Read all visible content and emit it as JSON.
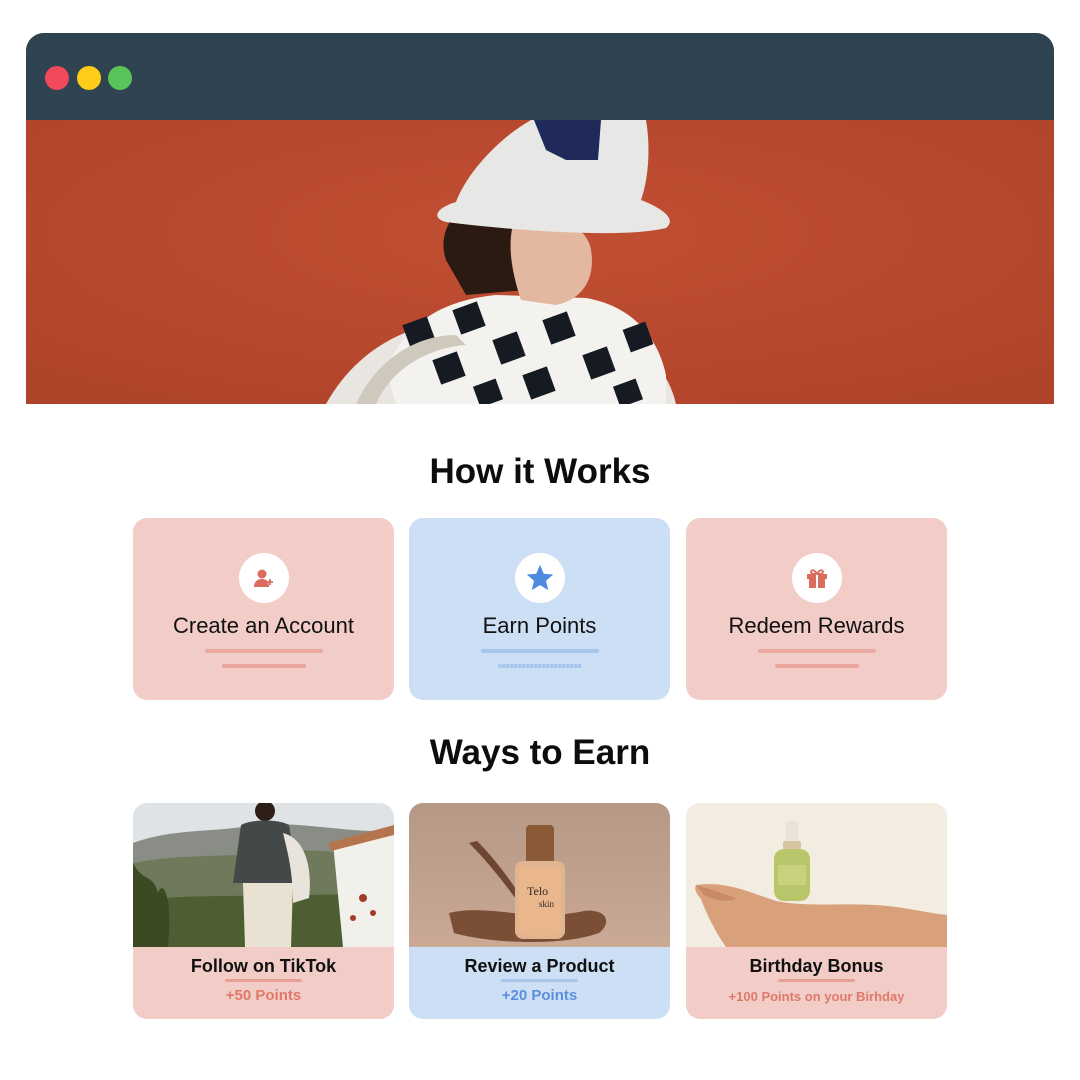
{
  "window": {
    "buttons": {
      "close": "close-dot",
      "minimize": "minimize-dot",
      "maximize": "maximize-dot"
    }
  },
  "colors": {
    "titlebar": "#2f4350",
    "hero": "#b9482f",
    "pink_card": "#f2cdc8",
    "blue_card": "#cddff4",
    "pink_accent": "#e0796a",
    "blue_accent": "#5b8fdc"
  },
  "sections": {
    "how_it_works": "How it Works",
    "ways_to_earn": "Ways to Earn"
  },
  "steps": [
    {
      "label": "Create an Account",
      "icon": "user-add-icon",
      "theme": "pink"
    },
    {
      "label": "Earn Points",
      "icon": "star-icon",
      "theme": "blue"
    },
    {
      "label": "Redeem Rewards",
      "icon": "gift-icon",
      "theme": "pink"
    }
  ],
  "ways": [
    {
      "label": "Follow on TikTok",
      "points": "+50 Points",
      "image": "man-in-landscape-photo",
      "theme": "pink"
    },
    {
      "label": "Review a Product",
      "points": "+20 Points",
      "image": "skincare-bottle-photo",
      "theme": "blue",
      "product_text": "Telo skin"
    },
    {
      "label": "Birthday Bonus",
      "points": "+100 Points on your Birhday",
      "image": "serum-on-hand-photo",
      "theme": "pink"
    }
  ]
}
